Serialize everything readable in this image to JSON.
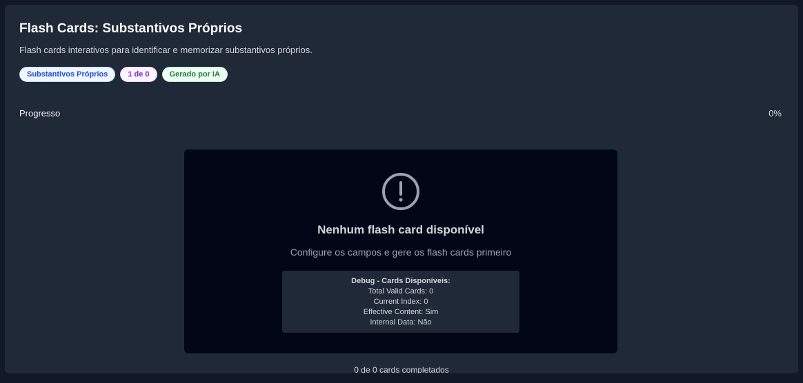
{
  "header": {
    "title": "Flash Cards: Substantivos Próprios",
    "subtitle": "Flash cards interativos para identificar e memorizar substantivos próprios."
  },
  "badges": {
    "topic": "Substantivos Próprios",
    "count": "1 de 0",
    "ai": "Gerado por IA"
  },
  "progress": {
    "label": "Progresso",
    "value_text": "0%",
    "fraction": 0
  },
  "empty_state": {
    "icon": "alert-circle-icon",
    "heading": "Nenhum flash card disponível",
    "text": "Configure os campos e gere os flash cards primeiro"
  },
  "debug": {
    "title": "Debug - Cards Disponíveis:",
    "total_valid": "Total Valid Cards: 0",
    "current_index": "Current Index: 0",
    "effective_content": "Effective Content: Sim",
    "internal_data": "Internal Data: Não"
  },
  "footer": {
    "completed": "0 de 0 cards completados"
  },
  "colors": {
    "background": "#111827",
    "panel": "#1f2937",
    "card": "#020617",
    "accent": "#3b82f6"
  }
}
